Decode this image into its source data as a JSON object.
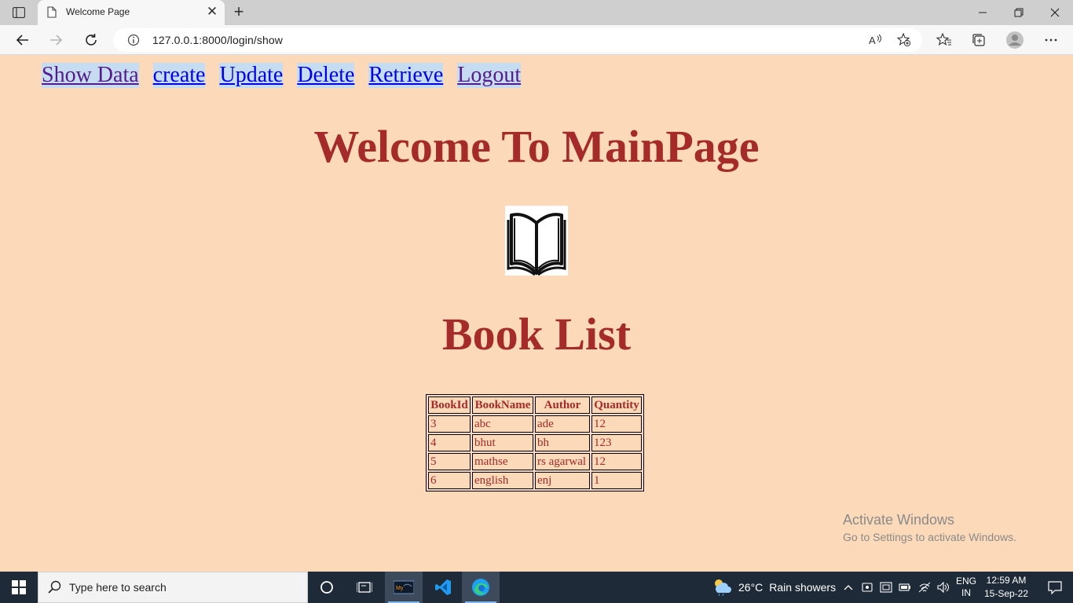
{
  "browser": {
    "tab_title": "Welcome Page",
    "tab_close": "✕",
    "new_tab": "+",
    "url": "127.0.0.1:8000/login/show"
  },
  "nav": {
    "show_data": "Show Data",
    "create": "create",
    "update": "Update",
    "delete": "Delete",
    "retrieve": "Retrieve",
    "logout": "Logout"
  },
  "page": {
    "heading": "Welcome To MainPage",
    "list_heading": "Book List"
  },
  "table": {
    "headers": [
      "BookId",
      "BookName",
      "Author",
      "Quantity"
    ],
    "rows": [
      [
        "3",
        "abc",
        "ade",
        "12"
      ],
      [
        "4",
        "bhut",
        "bh",
        "123"
      ],
      [
        "5",
        "mathse",
        "rs agarwal",
        "12"
      ],
      [
        "6",
        "english",
        "enj",
        "1"
      ]
    ]
  },
  "watermark": {
    "title": "Activate Windows",
    "subtitle": "Go to Settings to activate Windows."
  },
  "taskbar": {
    "search_placeholder": "Type here to search",
    "temperature": "26°C",
    "weather": "Rain showers",
    "lang_top": "ENG",
    "lang_bottom": "IN",
    "time": "12:59 AM",
    "date": "15-Sep-22"
  },
  "colors": {
    "page_background": "#fcd9b8",
    "heading": "#a52a2a",
    "link_highlight": "#c6dcf0",
    "taskbar": "#1f2a38"
  },
  "icons": [
    "tab-actions-icon",
    "page-icon",
    "close-icon",
    "plus-icon",
    "minimize-icon",
    "restore-icon",
    "window-close-icon",
    "back-icon",
    "forward-icon",
    "refresh-icon",
    "info-icon",
    "read-aloud-icon",
    "add-favorite-icon",
    "favorites-icon",
    "collections-icon",
    "profile-icon",
    "more-icon",
    "open-book-icon",
    "windows-logo-icon",
    "search-icon",
    "cortana-icon",
    "task-view-icon",
    "mysql-app-icon",
    "vscode-icon",
    "edge-icon",
    "weather-icon",
    "chevron-up-icon",
    "meet-now-icon",
    "network-card-icon",
    "battery-icon",
    "wifi-icon",
    "volume-icon",
    "notification-icon"
  ]
}
